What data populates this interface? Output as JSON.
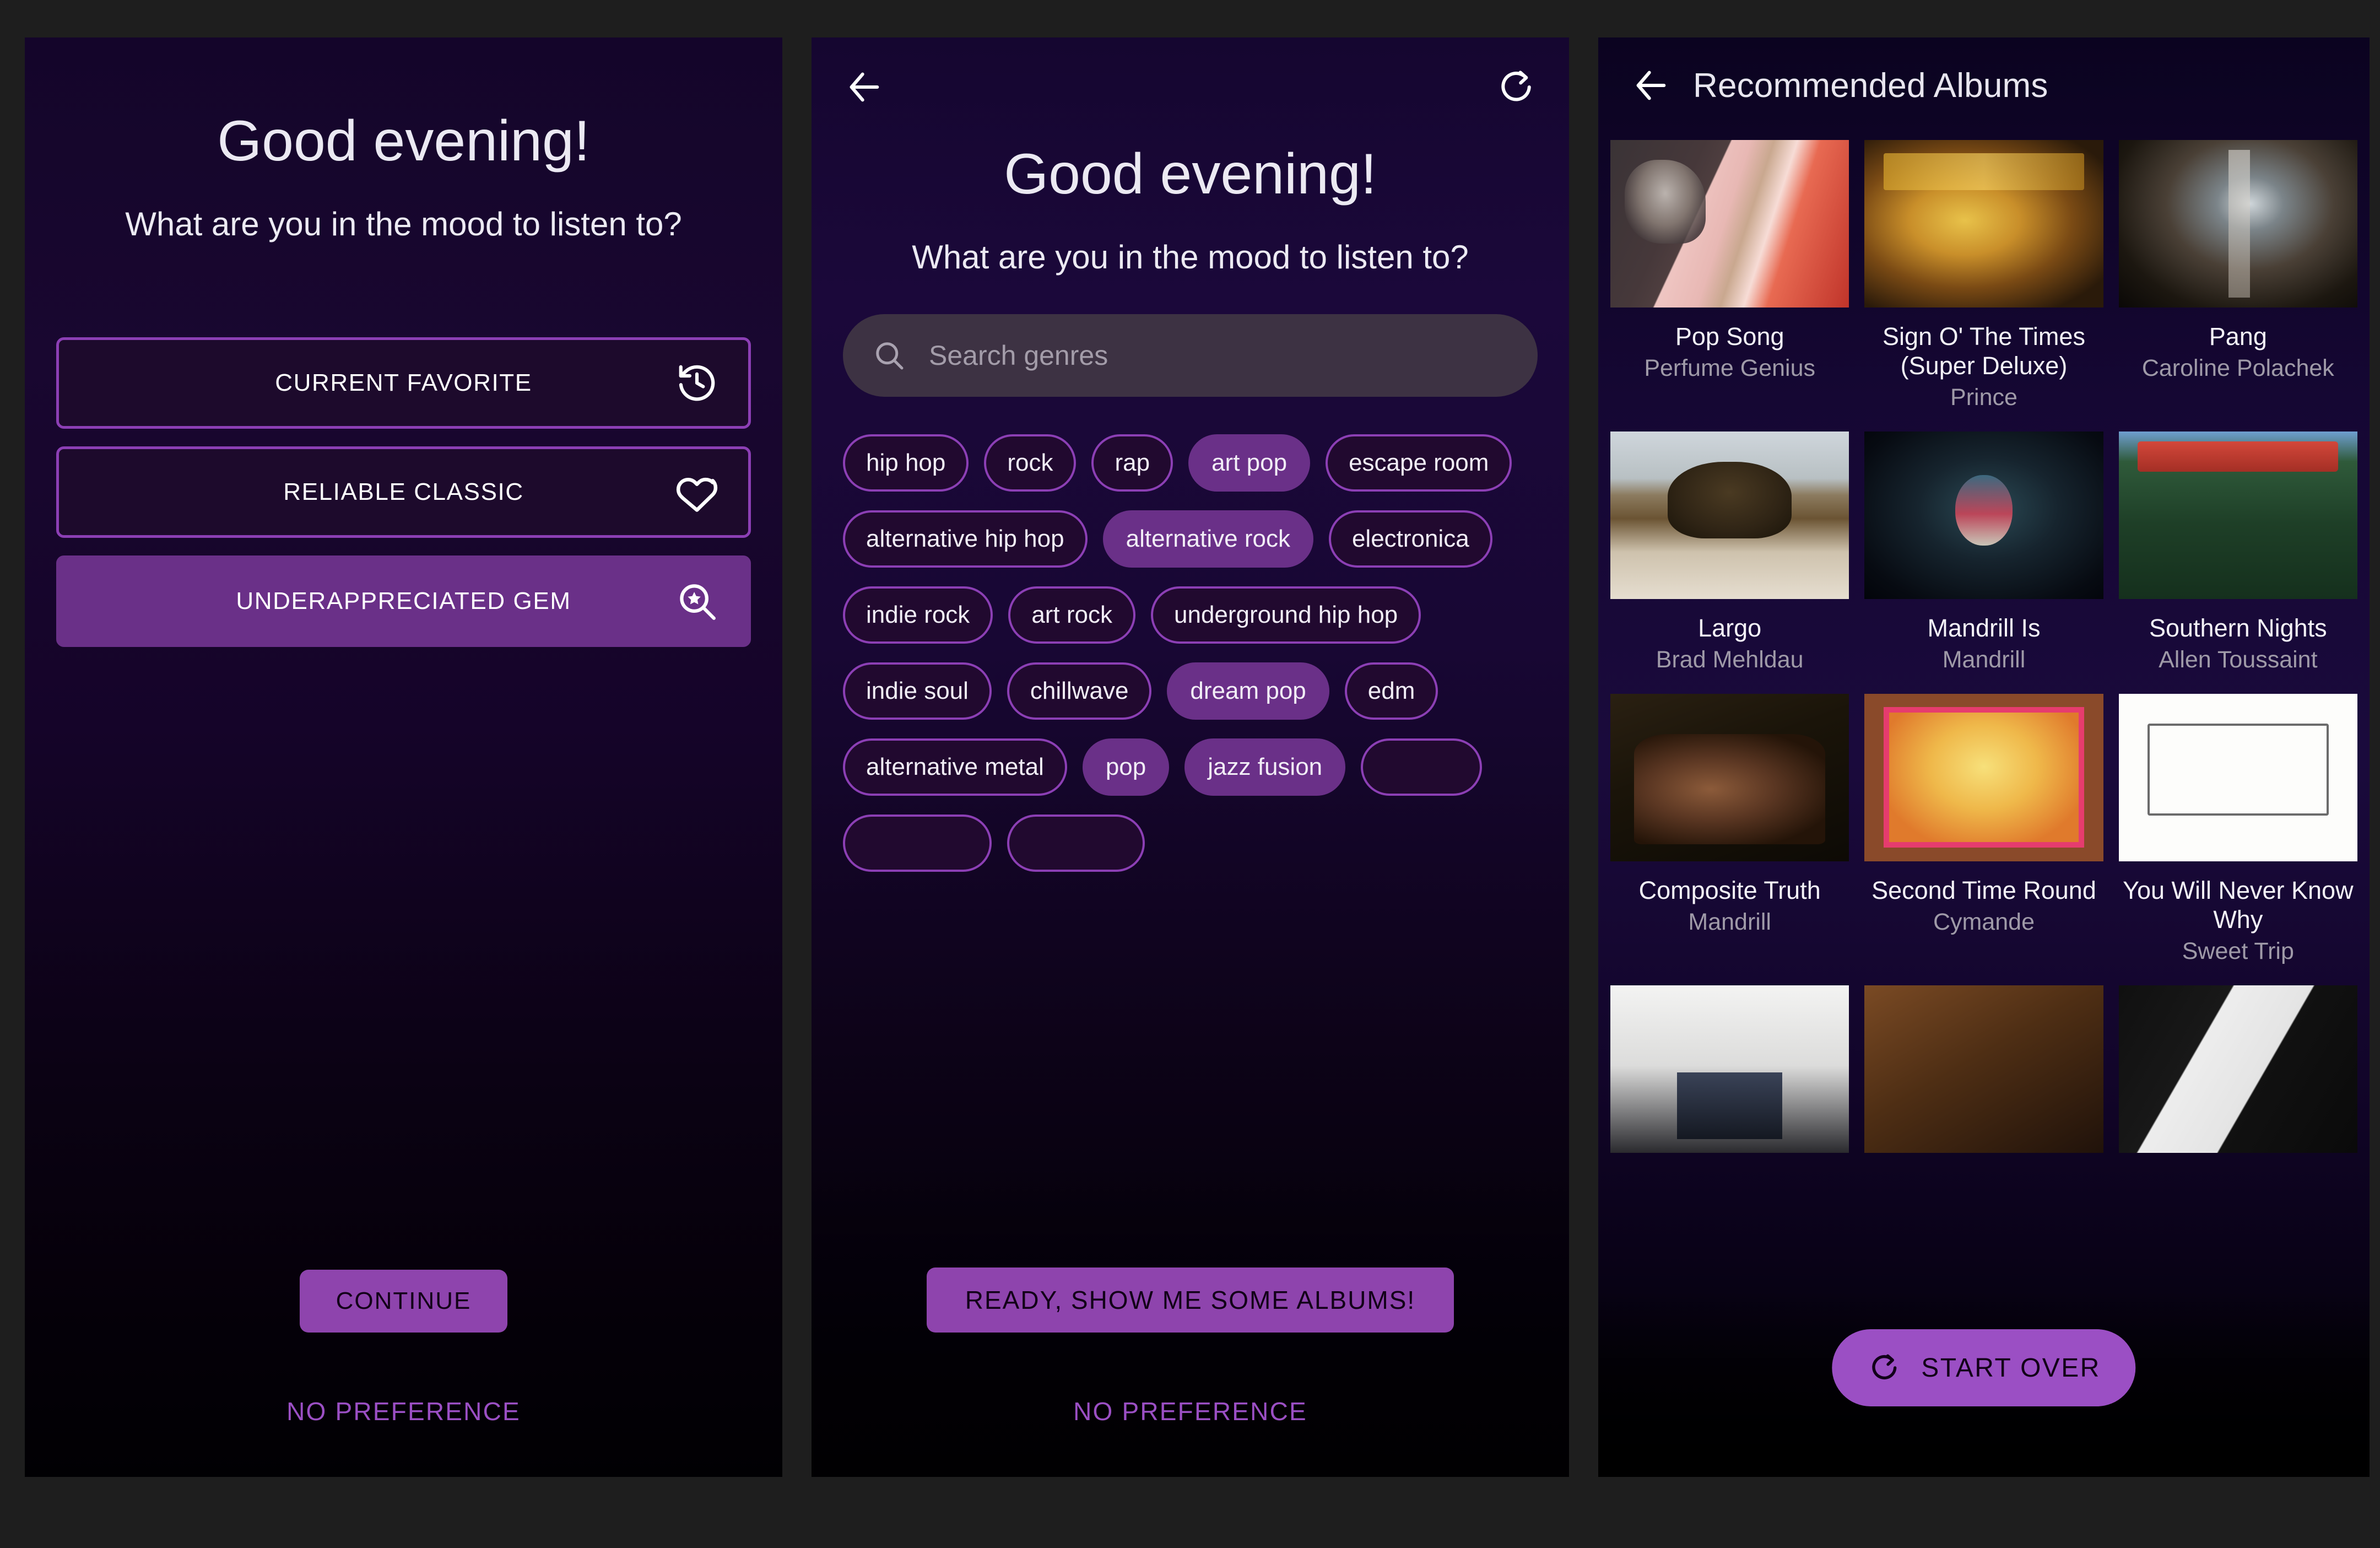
{
  "app": {
    "accent_purple": "#8e44ad",
    "accent_purple_light": "#9b4fc4",
    "chip_border": "#8c3fb5",
    "chip_selected_bg": "#6a3088",
    "search_bg": "#3d3243",
    "page_bg": "#1e1e1e"
  },
  "panel1": {
    "greeting": "Good evening!",
    "subprompt": "What are you in the mood to listen to?",
    "mood_options": [
      {
        "label": "CURRENT FAVORITE",
        "icon": "history-clock-icon",
        "selected": false
      },
      {
        "label": "RELIABLE CLASSIC",
        "icon": "heart-icon",
        "selected": false
      },
      {
        "label": "UNDERAPPRECIATED GEM",
        "icon": "star-magnifier-icon",
        "selected": true
      }
    ],
    "continue_label": "CONTINUE",
    "no_preference_label": "NO PREFERENCE"
  },
  "panel2": {
    "back_icon": "back-arrow-icon",
    "refresh_icon": "refresh-loop-icon",
    "greeting": "Good evening!",
    "subprompt": "What are you in the mood to listen to?",
    "search_placeholder": "Search genres",
    "search_value": "",
    "search_icon": "search-icon",
    "genres": [
      {
        "label": "hip hop",
        "selected": false
      },
      {
        "label": "rock",
        "selected": false
      },
      {
        "label": "rap",
        "selected": false
      },
      {
        "label": "art pop",
        "selected": true
      },
      {
        "label": "escape room",
        "selected": false
      },
      {
        "label": "alternative hip hop",
        "selected": false
      },
      {
        "label": "alternative rock",
        "selected": true
      },
      {
        "label": "electronica",
        "selected": false
      },
      {
        "label": "indie rock",
        "selected": false
      },
      {
        "label": "art rock",
        "selected": false
      },
      {
        "label": "underground hip hop",
        "selected": false
      },
      {
        "label": "indie soul",
        "selected": false
      },
      {
        "label": "chillwave",
        "selected": false
      },
      {
        "label": "dream pop",
        "selected": true
      },
      {
        "label": "edm",
        "selected": false
      },
      {
        "label": "alternative metal",
        "selected": false
      },
      {
        "label": "pop",
        "selected": true
      },
      {
        "label": "jazz fusion",
        "selected": true
      },
      {
        "label": "",
        "selected": false
      },
      {
        "label": "",
        "selected": false
      },
      {
        "label": "",
        "selected": false
      }
    ],
    "submit_label": "READY, SHOW ME SOME ALBUMS!",
    "no_preference_label": "NO PREFERENCE"
  },
  "panel3": {
    "back_icon": "back-arrow-icon",
    "title": "Recommended Albums",
    "albums": [
      {
        "title": "Pop Song",
        "artist": "Perfume Genius",
        "art": "art-popsong"
      },
      {
        "title": "Sign O' The Times (Super Deluxe)",
        "artist": "Prince",
        "art": "art-signo"
      },
      {
        "title": "Pang",
        "artist": "Caroline Polachek",
        "art": "art-pang"
      },
      {
        "title": "Largo",
        "artist": "Brad Mehldau",
        "art": "art-largo"
      },
      {
        "title": "Mandrill Is",
        "artist": "Mandrill",
        "art": "art-mandrillis"
      },
      {
        "title": "Southern Nights",
        "artist": "Allen Toussaint",
        "art": "art-southern"
      },
      {
        "title": "Composite Truth",
        "artist": "Mandrill",
        "art": "art-composite"
      },
      {
        "title": "Second Time Round",
        "artist": "Cymande",
        "art": "art-second"
      },
      {
        "title": "You Will Never Know Why",
        "artist": "Sweet Trip",
        "art": "art-youwill"
      },
      {
        "title": "",
        "artist": "",
        "art": "art-sound1"
      },
      {
        "title": "",
        "artist": "",
        "art": "art-sound2"
      },
      {
        "title": "",
        "artist": "",
        "art": "art-sound3"
      }
    ],
    "start_over_label": "START OVER",
    "start_over_icon": "refresh-loop-icon"
  }
}
